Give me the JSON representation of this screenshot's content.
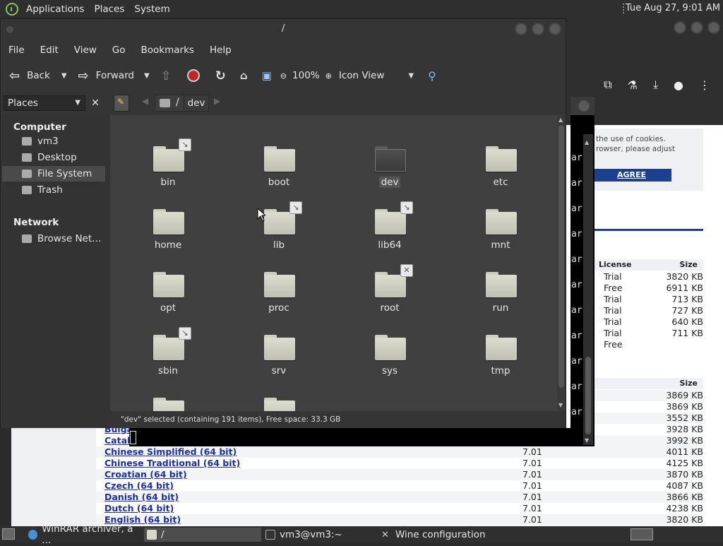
{
  "top_panel": {
    "menus": [
      "Applications",
      "Places",
      "System"
    ],
    "clock": "Tue Aug 27,  9:01 AM"
  },
  "fm": {
    "title": "/",
    "menubar": [
      "File",
      "Edit",
      "View",
      "Go",
      "Bookmarks",
      "Help"
    ],
    "toolbar": {
      "back": "Back",
      "forward": "Forward",
      "zoom": "100%",
      "view_mode": "Icon View"
    },
    "places_label": "Places",
    "breadcrumb": {
      "root": "/",
      "current": "dev"
    },
    "sidebar": {
      "computer_heading": "Computer",
      "computer_items": [
        "vm3",
        "Desktop",
        "File System",
        "Trash"
      ],
      "network_heading": "Network",
      "network_items": [
        "Browse Net…"
      ]
    },
    "folders": [
      {
        "name": "bin",
        "emblem": "link"
      },
      {
        "name": "boot",
        "emblem": ""
      },
      {
        "name": "dev",
        "emblem": "",
        "selected": true
      },
      {
        "name": "etc",
        "emblem": ""
      },
      {
        "name": "home",
        "emblem": ""
      },
      {
        "name": "lib",
        "emblem": "link"
      },
      {
        "name": "lib64",
        "emblem": "link"
      },
      {
        "name": "mnt",
        "emblem": ""
      },
      {
        "name": "opt",
        "emblem": ""
      },
      {
        "name": "proc",
        "emblem": ""
      },
      {
        "name": "root",
        "emblem": "noaccess"
      },
      {
        "name": "run",
        "emblem": ""
      },
      {
        "name": "sbin",
        "emblem": "link"
      },
      {
        "name": "srv",
        "emblem": ""
      },
      {
        "name": "sys",
        "emblem": ""
      },
      {
        "name": "tmp",
        "emblem": ""
      },
      {
        "name": "",
        "emblem": ""
      },
      {
        "name": "",
        "emblem": ""
      }
    ],
    "status": "\"dev\" selected (containing 191 items), Free space: 33.3 GB"
  },
  "terminal": {
    "line_fragments": [
      "ar",
      "ar",
      "ar",
      "ar",
      "ar",
      "ar",
      "ar",
      "ar",
      "ar",
      "ar",
      "ar"
    ]
  },
  "browser": {
    "cookie_text": [
      "the use of cookies.",
      "rowser, please adjust"
    ],
    "agree_label": "AGREE",
    "table1": {
      "headers": [
        "License",
        "Size"
      ],
      "rows": [
        [
          "Trial",
          "3820 KB"
        ],
        [
          "Free",
          "6911 KB"
        ],
        [
          "Trial",
          "713 KB"
        ],
        [
          "Trial",
          "727 KB"
        ],
        [
          "Trial",
          "640 KB"
        ],
        [
          "Trial",
          "711 KB"
        ],
        [
          "Free",
          ""
        ]
      ]
    },
    "table2": {
      "header": "Size",
      "top_sizes": [
        "3869 KB",
        "3869 KB",
        "3552 KB",
        "3928 KB",
        "3992 KB"
      ],
      "partial_langs": [
        "Bulga",
        "Catal"
      ],
      "rows": [
        {
          "lang": "Chinese Simplified (64 bit)",
          "ver": "7.01",
          "size": "4011 KB"
        },
        {
          "lang": "Chinese Traditional (64 bit)",
          "ver": "7.01",
          "size": "4125 KB"
        },
        {
          "lang": "Croatian (64 bit)",
          "ver": "7.01",
          "size": "3870 KB"
        },
        {
          "lang": "Czech (64 bit)",
          "ver": "7.01",
          "size": "4087 KB"
        },
        {
          "lang": "Danish (64 bit)",
          "ver": "7.01",
          "size": "3866 KB"
        },
        {
          "lang": "Dutch (64 bit)",
          "ver": "7.01",
          "size": "4238 KB"
        },
        {
          "lang": "English (64 bit)",
          "ver": "7.01",
          "size": "3820 KB"
        }
      ]
    }
  },
  "taskbar": {
    "tasks": [
      "WinRAR archiver, a ...",
      "/",
      "vm3@vm3:~",
      "Wine configuration"
    ]
  }
}
